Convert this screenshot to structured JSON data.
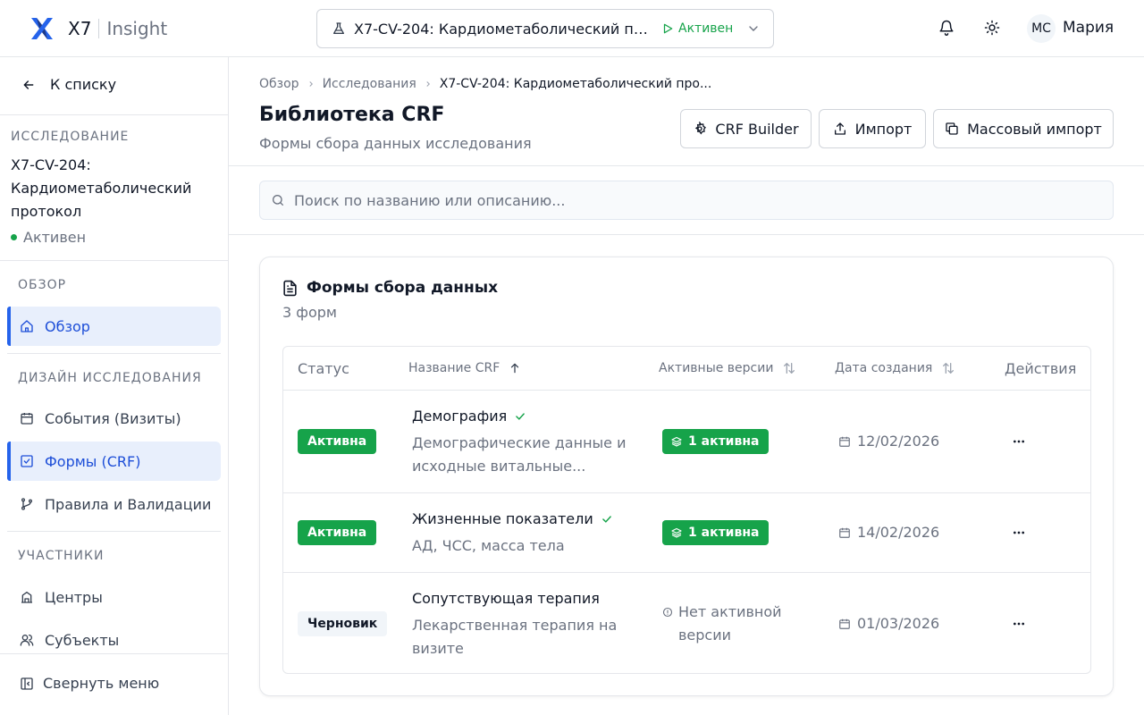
{
  "header": {
    "brand": "X7",
    "product": "Insight",
    "study_title": "X7-CV-204: Кардиометаболический протокол",
    "study_status": "Активен",
    "user_initials": "МС",
    "user_name": "Мария"
  },
  "sidebar": {
    "back_label": "К списку",
    "study_section": "ИССЛЕДОВАНИЕ",
    "study_name": "X7-CV-204: Кардиометаболический протокол",
    "study_status": "Активен",
    "sections": [
      {
        "label": "ОБЗОР"
      },
      {
        "label": "ДИЗАЙН ИССЛЕДОВАНИЯ"
      },
      {
        "label": "УЧАСТНИКИ"
      }
    ],
    "items": [
      {
        "label": "Обзор"
      },
      {
        "label": "События (Визиты)"
      },
      {
        "label": "Формы (CRF)"
      },
      {
        "label": "Правила и Валидации"
      },
      {
        "label": "Центры"
      },
      {
        "label": "Субъекты"
      }
    ],
    "collapse_label": "Свернуть меню"
  },
  "breadcrumb": [
    "Обзор",
    "Исследования",
    "X7-CV-204: Кардиометаболический про..."
  ],
  "page": {
    "title": "Библиотека CRF",
    "subtitle": "Формы сбора данных исследования",
    "buttons": {
      "builder": "CRF Builder",
      "import": "Импорт",
      "bulk_import": "Массовый импорт"
    }
  },
  "search": {
    "placeholder": "Поиск по названию или описанию...",
    "value": ""
  },
  "card": {
    "title": "Формы сбора данных",
    "count": "3 форм",
    "columns": {
      "status": "Статус",
      "name": "Название CRF",
      "versions": "Активные версии",
      "created": "Дата создания",
      "actions": "Действия"
    },
    "rows": [
      {
        "status": "Активна",
        "name": "Демография",
        "desc": "Демографические данные и исходные витальные...",
        "version": "1 активна",
        "date": "12/02/2026"
      },
      {
        "status": "Активна",
        "name": "Жизненные показатели",
        "desc": "АД, ЧСС, масса тела",
        "version": "1 активна",
        "date": "14/02/2026"
      },
      {
        "status": "Черновик",
        "name": "Сопутствующая терапия",
        "desc": "Лекарственная терапия на визите",
        "version": "Нет активной версии",
        "date": "01/03/2026"
      }
    ]
  },
  "colors": {
    "accent": "#2563eb",
    "success": "#16a34a",
    "muted": "#6b7280"
  }
}
